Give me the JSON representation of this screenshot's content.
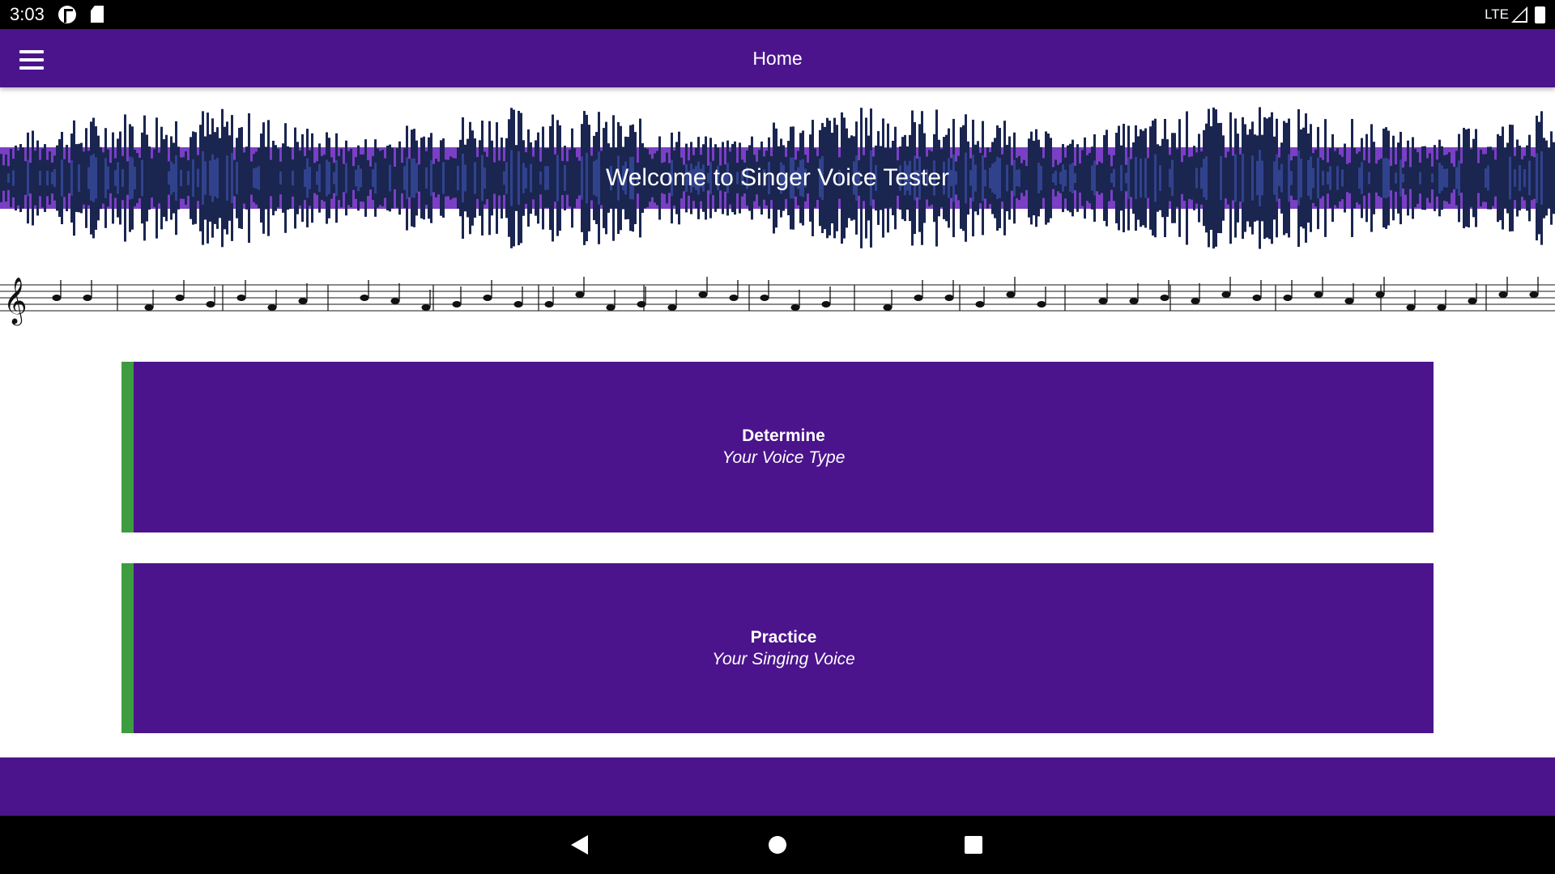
{
  "status_bar": {
    "time": "3:03",
    "network": "LTE",
    "icons": [
      "pandora-icon",
      "sd-card-icon",
      "signal-icon",
      "battery-icon"
    ]
  },
  "app_bar": {
    "title": "Home",
    "menu_icon": "hamburger-menu-icon"
  },
  "hero": {
    "welcome_text": "Welcome to Singer Voice Tester"
  },
  "cards": [
    {
      "title": "Determine",
      "subtitle": "Your Voice Type"
    },
    {
      "title": "Practice",
      "subtitle": "Your Singing Voice"
    }
  ],
  "nav_bar": {
    "icons": [
      "back-icon",
      "home-icon",
      "recents-icon"
    ]
  },
  "colors": {
    "primary": "#4b148c",
    "accent": "#3d9c3f",
    "waveform": "#1a2550",
    "band": "#7a3fc4"
  }
}
